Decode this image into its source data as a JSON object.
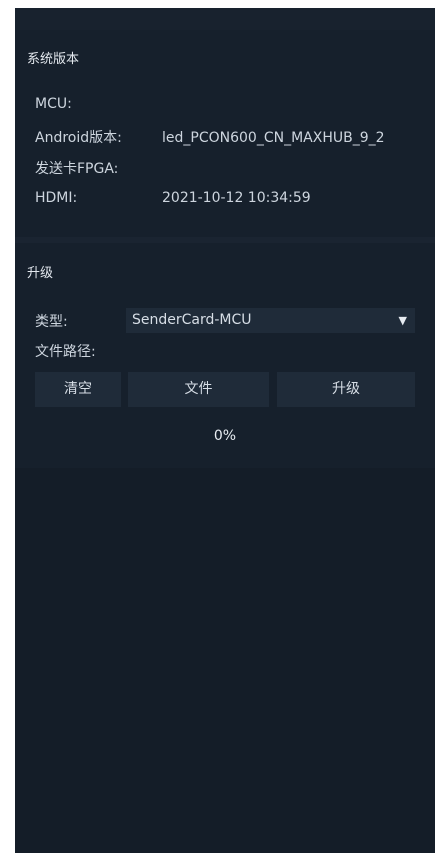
{
  "version_section": {
    "title": "系统版本",
    "rows": [
      {
        "label": "MCU:",
        "value": ""
      },
      {
        "label": "Android版本:",
        "value": "led_PCON600_CN_MAXHUB_9_2"
      },
      {
        "label": "发送卡FPGA:",
        "value": ""
      },
      {
        "label": "HDMI:",
        "value": "2021-10-12 10:34:59"
      }
    ]
  },
  "upgrade_section": {
    "title": "升级",
    "type_label": "类型:",
    "type_value": "SenderCard-MCU",
    "file_path_label": "文件路径:",
    "buttons": {
      "clear": "清空",
      "file": "文件",
      "upgrade": "升级"
    },
    "progress": "0%"
  },
  "colors": {
    "panel_bg": "#16202c",
    "control_bg": "#1f2b39"
  },
  "icons": {
    "dropdown": "▼"
  }
}
